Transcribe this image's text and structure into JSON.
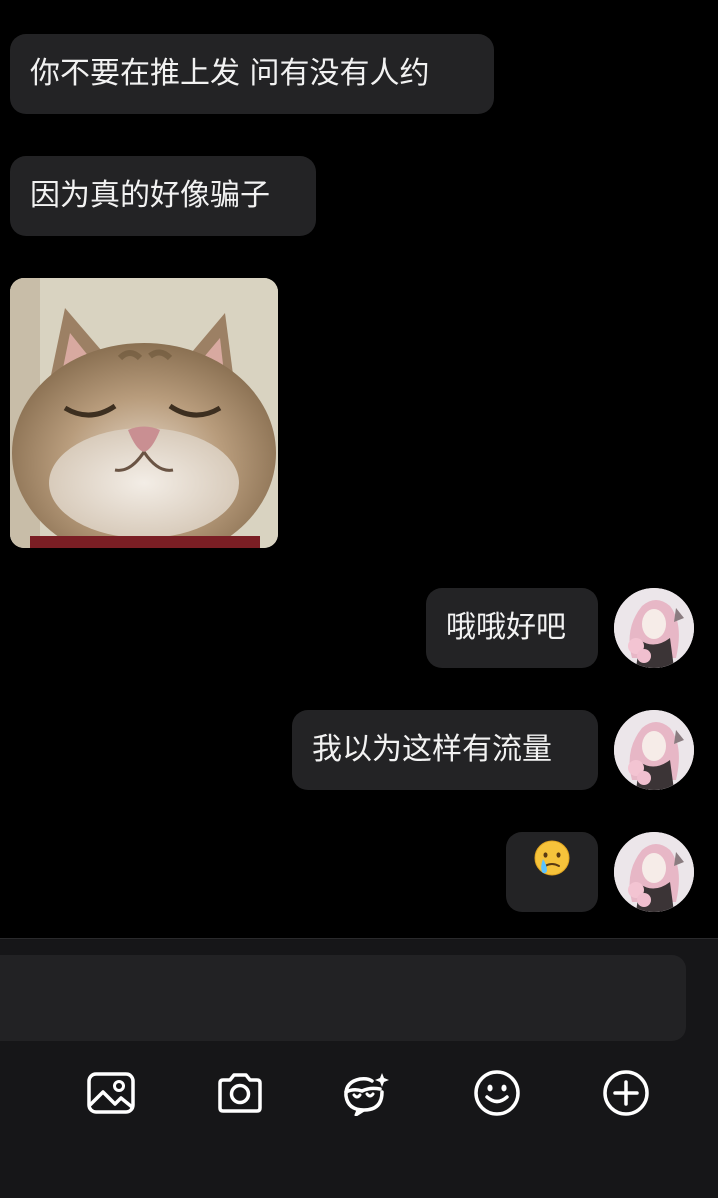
{
  "messages": [
    {
      "side": "left",
      "type": "text",
      "text": "你不要在推上发 问有没有人约"
    },
    {
      "side": "left",
      "type": "text",
      "text": "因为真的好像骗子"
    },
    {
      "side": "left",
      "type": "image",
      "image": "smiling-cat-photo"
    },
    {
      "side": "right",
      "type": "text",
      "text": "哦哦好吧"
    },
    {
      "side": "right",
      "type": "text",
      "text": "我以为这样有流量"
    },
    {
      "side": "right",
      "type": "emoji",
      "emoji": "😢",
      "icon": "crying-face-icon"
    }
  ],
  "composer": {
    "value": "",
    "placeholder": ""
  },
  "toolbar": {
    "icons": [
      "image-icon",
      "camera-icon",
      "sticker-icon",
      "emoji-icon",
      "plus-icon"
    ]
  },
  "colors": {
    "background": "#000000",
    "bubble": "#232325",
    "panel": "#161618",
    "input": "#222224",
    "icon": "#ffffff"
  }
}
